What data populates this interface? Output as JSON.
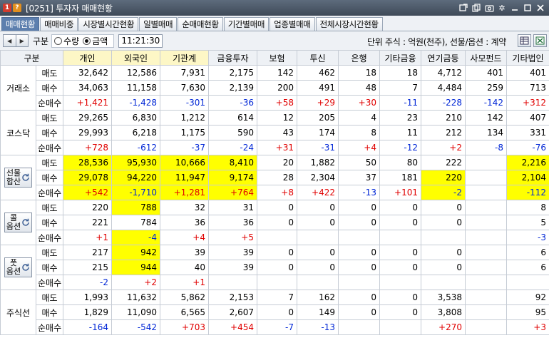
{
  "window": {
    "screen_no": "[0251]",
    "title": "투자자 매매현황",
    "badge1": "1",
    "badge2": "?"
  },
  "tabs": [
    {
      "label": "매매현황",
      "active": true
    },
    {
      "label": "매매비중",
      "active": false
    },
    {
      "label": "시장별시간현황",
      "active": false
    },
    {
      "label": "일별매매",
      "active": false
    },
    {
      "label": "순매매현황",
      "active": false
    },
    {
      "label": "기간별매매",
      "active": false
    },
    {
      "label": "업종별매매",
      "active": false
    },
    {
      "label": "전체시장시간현황",
      "active": false
    }
  ],
  "controls": {
    "section_label": "구분",
    "radio_qty": "수량",
    "radio_amount": "금액",
    "selected": "금액",
    "time": "11:21:30",
    "unit_text": "단위 주식 : 억원(천주), 선물/옵션 : 계약"
  },
  "columns": [
    "구분",
    "개인",
    "외국인",
    "기관계",
    "금융투자",
    "보험",
    "투신",
    "은행",
    "기타금융",
    "연기금등",
    "사모펀드",
    "기타법인"
  ],
  "highlight_columns": [
    1,
    2,
    3
  ],
  "groups": [
    {
      "label": "거래소",
      "has_button": false,
      "rows": [
        {
          "kind": "매도",
          "values": [
            "32,642",
            "12,586",
            "7,931",
            "2,175",
            "142",
            "462",
            "18",
            "18",
            "4,712",
            "401",
            "401"
          ],
          "yellow": [],
          "colors": []
        },
        {
          "kind": "매수",
          "values": [
            "34,063",
            "11,158",
            "7,630",
            "2,139",
            "200",
            "491",
            "48",
            "7",
            "4,484",
            "259",
            "713"
          ],
          "yellow": [],
          "colors": []
        },
        {
          "kind": "순매수",
          "values": [
            "+1,421",
            "-1,428",
            "-301",
            "-36",
            "+58",
            "+29",
            "+30",
            "-11",
            "-228",
            "-142",
            "+312"
          ],
          "yellow": [],
          "colors": [
            "r",
            "b",
            "b",
            "b",
            "r",
            "r",
            "r",
            "b",
            "b",
            "b",
            "r"
          ]
        }
      ]
    },
    {
      "label": "코스닥",
      "has_button": false,
      "rows": [
        {
          "kind": "매도",
          "values": [
            "29,265",
            "6,830",
            "1,212",
            "614",
            "12",
            "205",
            "4",
            "23",
            "210",
            "142",
            "407"
          ],
          "yellow": [],
          "colors": []
        },
        {
          "kind": "매수",
          "values": [
            "29,993",
            "6,218",
            "1,175",
            "590",
            "43",
            "174",
            "8",
            "11",
            "212",
            "134",
            "331"
          ],
          "yellow": [],
          "colors": []
        },
        {
          "kind": "순매수",
          "values": [
            "+728",
            "-612",
            "-37",
            "-24",
            "+31",
            "-31",
            "+4",
            "-12",
            "+2",
            "-8",
            "-76"
          ],
          "yellow": [],
          "colors": [
            "r",
            "b",
            "b",
            "b",
            "r",
            "b",
            "r",
            "b",
            "r",
            "b",
            "b"
          ]
        }
      ]
    },
    {
      "label": "선물합산",
      "label_lines": [
        "선물",
        "합산"
      ],
      "has_button": true,
      "rows": [
        {
          "kind": "매도",
          "values": [
            "28,536",
            "95,930",
            "10,666",
            "8,410",
            "20",
            "1,882",
            "50",
            "80",
            "222",
            "",
            "2,216"
          ],
          "yellow": [
            0,
            1,
            2,
            3,
            10
          ],
          "colors": []
        },
        {
          "kind": "매수",
          "values": [
            "29,078",
            "94,220",
            "11,947",
            "9,174",
            "28",
            "2,304",
            "37",
            "181",
            "220",
            "",
            "2,104"
          ],
          "yellow": [
            0,
            1,
            2,
            3,
            8,
            10
          ],
          "colors": []
        },
        {
          "kind": "순매수",
          "values": [
            "+542",
            "-1,710",
            "+1,281",
            "+764",
            "+8",
            "+422",
            "-13",
            "+101",
            "-2",
            "",
            "-112"
          ],
          "yellow": [
            0,
            1,
            2,
            3,
            8,
            10
          ],
          "colors": [
            "r",
            "b",
            "r",
            "r",
            "r",
            "r",
            "b",
            "r",
            "b",
            "",
            "b"
          ]
        }
      ]
    },
    {
      "label": "콜옵션",
      "label_lines": [
        "콜",
        "옵션"
      ],
      "has_button": true,
      "rows": [
        {
          "kind": "매도",
          "values": [
            "220",
            "788",
            "32",
            "31",
            "0",
            "0",
            "0",
            "0",
            "0",
            "",
            "8"
          ],
          "yellow": [
            1
          ],
          "colors": []
        },
        {
          "kind": "매수",
          "values": [
            "221",
            "784",
            "36",
            "36",
            "0",
            "0",
            "0",
            "0",
            "0",
            "",
            "5"
          ],
          "yellow": [],
          "colors": []
        },
        {
          "kind": "순매수",
          "values": [
            "+1",
            "-4",
            "+4",
            "+5",
            "",
            "",
            "",
            "",
            "",
            "",
            "-3"
          ],
          "yellow": [
            1
          ],
          "colors": [
            "r",
            "b",
            "r",
            "r",
            "",
            "",
            "",
            "",
            "",
            "",
            "b"
          ]
        }
      ]
    },
    {
      "label": "풋옵션",
      "label_lines": [
        "풋",
        "옵션"
      ],
      "has_button": true,
      "rows": [
        {
          "kind": "매도",
          "values": [
            "217",
            "942",
            "39",
            "39",
            "0",
            "0",
            "0",
            "0",
            "0",
            "",
            "6"
          ],
          "yellow": [
            1
          ],
          "colors": []
        },
        {
          "kind": "매수",
          "values": [
            "215",
            "944",
            "40",
            "39",
            "0",
            "0",
            "0",
            "0",
            "0",
            "",
            "6"
          ],
          "yellow": [
            1
          ],
          "colors": []
        },
        {
          "kind": "순매수",
          "values": [
            "-2",
            "+2",
            "+1",
            "",
            "",
            "",
            "",
            "",
            "",
            "",
            ""
          ],
          "yellow": [],
          "colors": [
            "b",
            "r",
            "r",
            "",
            "",
            "",
            "",
            "",
            "",
            "",
            ""
          ]
        }
      ]
    },
    {
      "label": "주식선",
      "has_button": false,
      "rows": [
        {
          "kind": "매도",
          "values": [
            "1,993",
            "11,632",
            "5,862",
            "2,153",
            "7",
            "162",
            "0",
            "0",
            "3,538",
            "",
            "92"
          ],
          "yellow": [],
          "colors": []
        },
        {
          "kind": "매수",
          "values": [
            "1,829",
            "11,090",
            "6,565",
            "2,607",
            "0",
            "149",
            "0",
            "0",
            "3,808",
            "",
            "95"
          ],
          "yellow": [],
          "colors": []
        },
        {
          "kind": "순매수",
          "values": [
            "-164",
            "-542",
            "+703",
            "+454",
            "-7",
            "-13",
            "",
            "",
            "+270",
            "",
            "+3"
          ],
          "yellow": [],
          "colors": [
            "b",
            "b",
            "r",
            "r",
            "b",
            "b",
            "",
            "",
            "r",
            "",
            "r"
          ]
        }
      ]
    }
  ],
  "theme": {
    "accent": "#5d7fae",
    "highlight": "#ffff00",
    "up": "#e00000",
    "down": "#0026d6"
  },
  "icons": [
    "refresh-icon",
    "grid-settings-icon",
    "excel-export-icon",
    "link-icon",
    "copy-icon",
    "camera-icon",
    "gear-icon",
    "minimize-icon",
    "maximize-icon",
    "close-icon"
  ]
}
